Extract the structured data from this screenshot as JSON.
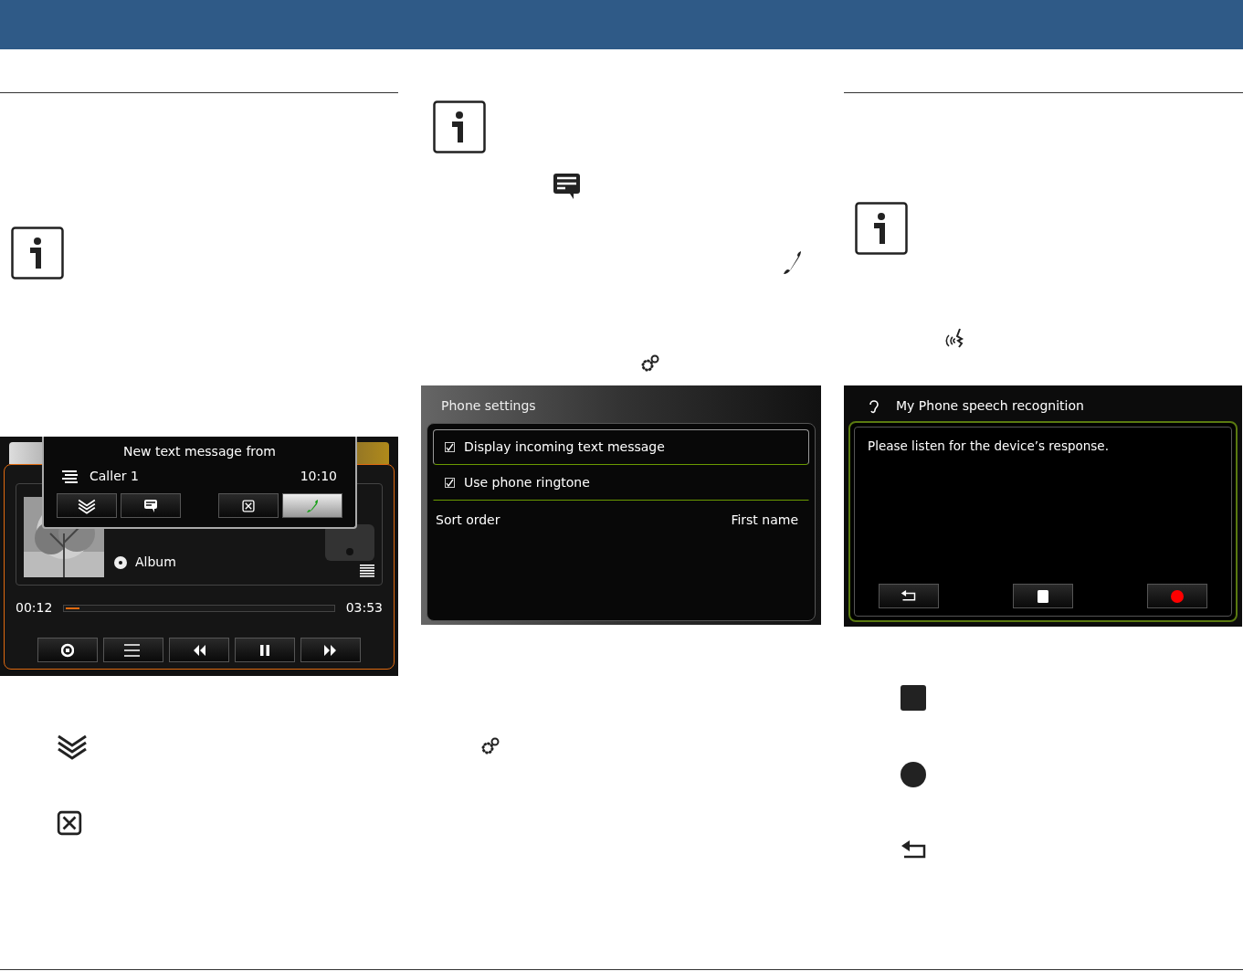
{
  "media_screen": {
    "popup": {
      "title": "New text message from",
      "caller": "Caller 1",
      "time": "10:10"
    },
    "album": "Album",
    "elapsed": "00:12",
    "total": "03:53",
    "progress": {
      "level": 0.05
    }
  },
  "settings_screen": {
    "title": "Phone settings",
    "options": [
      {
        "label": "Display incoming text message",
        "checked": true,
        "selected": true
      },
      {
        "label": "Use phone ringtone",
        "checked": true,
        "selected": false
      }
    ],
    "sort_order": {
      "label": "Sort order",
      "value": "First name"
    }
  },
  "speech_screen": {
    "title": "My Phone speech recognition",
    "message": "Please listen for the device’s response."
  }
}
